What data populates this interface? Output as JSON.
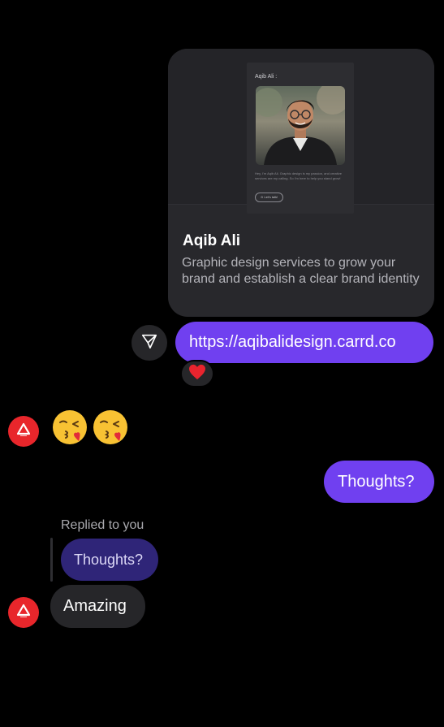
{
  "link_preview": {
    "site_name": "Aqib Ali :",
    "site_bio": "Hey, I'm Aqib Ali. Graphic design is my passion, and creative services are my calling. So I'm here to help you stand grow!",
    "site_button": "Let's talk!",
    "title": "Aqib Ali",
    "description": "Graphic design services to grow your brand and establish a clear brand identity"
  },
  "messages": {
    "link_text": "https://aqibalidesign.carrd.co",
    "reaction": "heart",
    "emoji_reply": [
      "kissing-face-with-heart",
      "kissing-face-with-heart"
    ],
    "outgoing_question": "Thoughts?",
    "replied_label": "Replied to you",
    "quoted_text": "Thoughts?",
    "incoming_reply": "Amazing"
  },
  "colors": {
    "outgoing_bubble": "#7040f0",
    "quoted_bubble": "#2f2578",
    "incoming_bubble": "#262629",
    "avatar": "#e8262b",
    "background": "#000000"
  },
  "icons": {
    "share": "send-icon",
    "avatar_logo": "triangle-logo-icon"
  }
}
